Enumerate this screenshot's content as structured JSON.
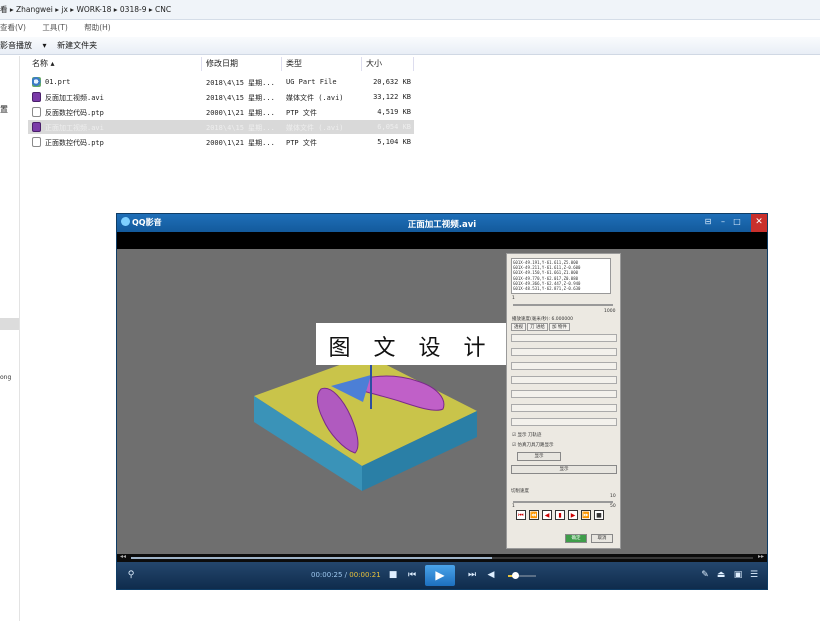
{
  "explorer": {
    "address": "看 ▸ Zhangwei ▸ jx ▸ WORK-18 ▸ 0318-9 ▸ CNC",
    "menu": [
      "查看(V)",
      "工具(T)",
      "帮助(H)"
    ],
    "toolbar": {
      "play_label": "影音播放",
      "dropdown": "▾",
      "new_folder": "新建文件夹"
    },
    "nav": {
      "item1": "置",
      "item2": "ong"
    },
    "columns": {
      "name": "名称",
      "date": "修改日期",
      "type": "类型",
      "size": "大小"
    },
    "files": [
      {
        "name": "01.prt",
        "date": "2018\\4\\15 星期...",
        "type": "UG Part File",
        "size": "20,632 KB",
        "icon": "prt"
      },
      {
        "name": "反面加工视频.avi",
        "date": "2018\\4\\15 星期...",
        "type": "媒体文件 (.avi)",
        "size": "33,122 KB",
        "icon": "avi"
      },
      {
        "name": "反面数控代码.ptp",
        "date": "2000\\1\\21 星期...",
        "type": "PTP 文件",
        "size": "4,519 KB",
        "icon": "ptp"
      },
      {
        "name": "正面加工视频.avi",
        "date": "2018\\4\\15 星期...",
        "type": "媒体文件 (.avi)",
        "size": "6,054 KB",
        "icon": "avi",
        "selected": true
      },
      {
        "name": "正面数控代码.ptp",
        "date": "2000\\1\\21 星期...",
        "type": "PTP 文件",
        "size": "5,104 KB",
        "icon": "ptp"
      }
    ]
  },
  "player": {
    "app_name": "QQ影音",
    "title": "正面加工视频.avi",
    "watermark": "图 文 设 计",
    "time_current": "00:00:25",
    "time_separator": " / ",
    "time_total": "00:00:21",
    "progress_fraction": 0.58,
    "volume_fraction": 0.25,
    "colors": {
      "title_bar": "#1f6fb8",
      "close": "#c9302c",
      "controls": "#0f2c4c",
      "accent": "#e8c13a"
    }
  },
  "cnc_panel": {
    "code_lines": [
      "G01X-49.191,Y-61.611,Z5.000",
      "G01X-49.211,Y-61.611,Z-0.600",
      "G01X-49.150,Y-61.661,Z1.000",
      "G01X-49.770,Y-62.017,Z0.080",
      "G01X-49.366,Y-62.447,Z-0.940",
      "G01X-48.531,Y-62.871,Z-0.630"
    ],
    "scale_min": "1",
    "scale_max": "1000",
    "speed_label": "播放速度(毫米/秒): 6.000000",
    "tabs": [
      "透视",
      "刀 进给",
      "加 物件"
    ],
    "step_min": "1",
    "step_mid": "10",
    "step_max": "50",
    "speed2_label": "切削速度",
    "display_btn": "显示",
    "check1": "显示 刀轨迹",
    "check2": "仿真刀具刀路显示",
    "reset_btn": "显示",
    "ok": "确定",
    "cancel": "取消"
  }
}
